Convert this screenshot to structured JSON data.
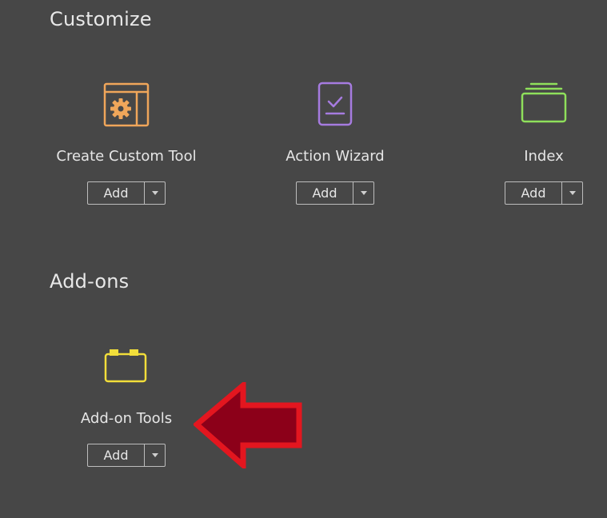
{
  "sections": {
    "customize": {
      "title": "Customize",
      "tools": [
        {
          "label": "Create Custom Tool",
          "icon": "custom-tool-gear-icon",
          "color": "#F0A65A",
          "add_label": "Add"
        },
        {
          "label": "Action Wizard",
          "icon": "action-wizard-checklist-icon",
          "color": "#A67BE0",
          "add_label": "Add"
        },
        {
          "label": "Index",
          "icon": "index-stack-icon",
          "color": "#8FE05B",
          "add_label": "Add"
        }
      ]
    },
    "addons": {
      "title": "Add-ons",
      "tools": [
        {
          "label": "Add-on Tools",
          "icon": "addon-brick-icon",
          "color": "#F2DE3A",
          "add_label": "Add"
        }
      ]
    }
  },
  "annotation": {
    "icon": "red-pointer-arrow-icon",
    "color": "#E3161F",
    "fill": "#8C0019"
  }
}
